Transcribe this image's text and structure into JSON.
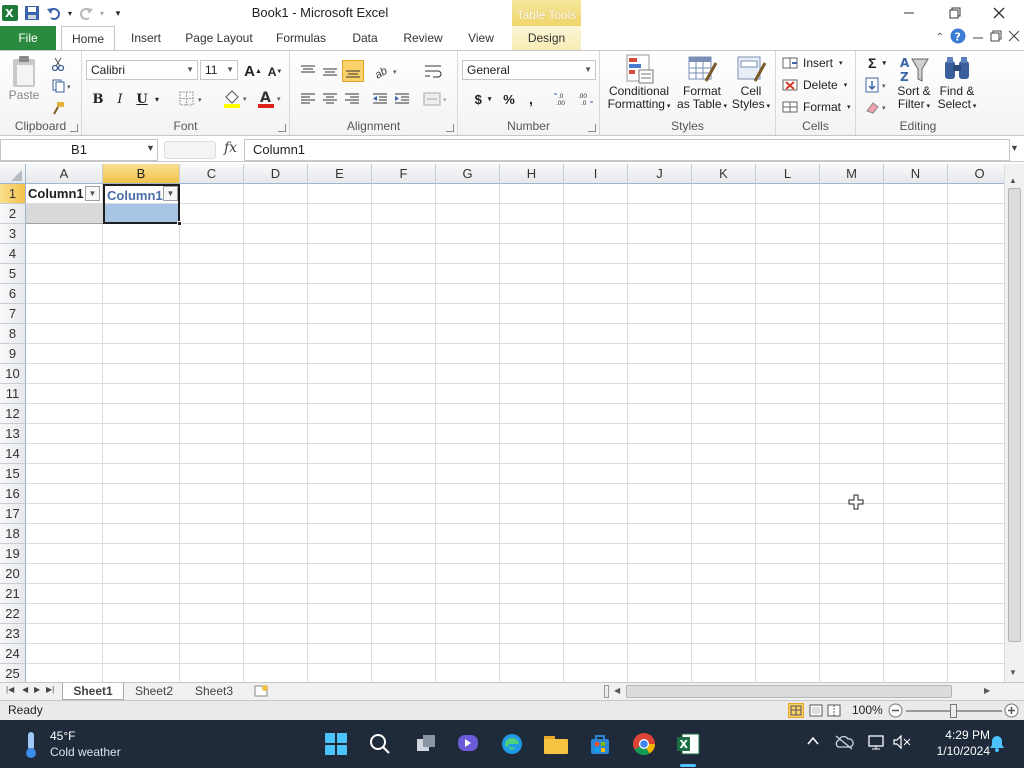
{
  "window": {
    "title": "Book1  -  Microsoft Excel",
    "context_tab": "Table Tools"
  },
  "tabs": {
    "file": "File",
    "items": [
      "Home",
      "Insert",
      "Page Layout",
      "Formulas",
      "Data",
      "Review",
      "View",
      "Design"
    ],
    "active": "Home"
  },
  "ribbon": {
    "clipboard": {
      "label": "Clipboard",
      "paste": "Paste"
    },
    "font": {
      "label": "Font",
      "name": "Calibri",
      "size": "11",
      "bold": "B",
      "italic": "I",
      "underline": "U"
    },
    "alignment": {
      "label": "Alignment"
    },
    "number": {
      "label": "Number",
      "format": "General",
      "currency": "$",
      "percent": "%",
      "comma": ",",
      "inc_decimal": ".0\n.00",
      "dec_decimal": ".00\n.0"
    },
    "styles": {
      "label": "Styles",
      "conditional_1": "Conditional",
      "conditional_2": "Formatting",
      "format_table_1": "Format",
      "format_table_2": "as Table",
      "cell_styles_1": "Cell",
      "cell_styles_2": "Styles"
    },
    "cells": {
      "label": "Cells",
      "insert": "Insert",
      "delete": "Delete",
      "format": "Format"
    },
    "editing": {
      "label": "Editing",
      "sort_1": "Sort &",
      "sort_2": "Filter",
      "find_1": "Find &",
      "find_2": "Select",
      "sum": "Σ"
    }
  },
  "formula_bar": {
    "name_box": "B1",
    "fx": "fx",
    "value": "Column1"
  },
  "grid": {
    "columns": [
      "A",
      "B",
      "C",
      "D",
      "E",
      "F",
      "G",
      "H",
      "I",
      "J",
      "K",
      "L",
      "M",
      "N",
      "O"
    ],
    "rows": [
      "1",
      "2",
      "3",
      "4",
      "5",
      "6",
      "7",
      "8",
      "9",
      "10",
      "11",
      "12",
      "13",
      "14",
      "15",
      "16",
      "17",
      "18",
      "19",
      "20",
      "21",
      "22",
      "23",
      "24",
      "25"
    ],
    "selected_column": "B",
    "selected_row": "1",
    "table_headers": [
      "Column1",
      "Column1"
    ]
  },
  "sheets": [
    "Sheet1",
    "Sheet2",
    "Sheet3"
  ],
  "active_sheet": "Sheet1",
  "status": {
    "ready": "Ready",
    "zoom": "100%"
  },
  "taskbar": {
    "temperature": "45°F",
    "weather": "Cold weather",
    "time": "4:29 PM",
    "date": "1/10/2024"
  },
  "colors": {
    "file_tab": "#2a8a3e",
    "selection_header": "#f1c14b",
    "table_header_text": "#4a6ea9",
    "taskbar": "#1f2a3a"
  }
}
